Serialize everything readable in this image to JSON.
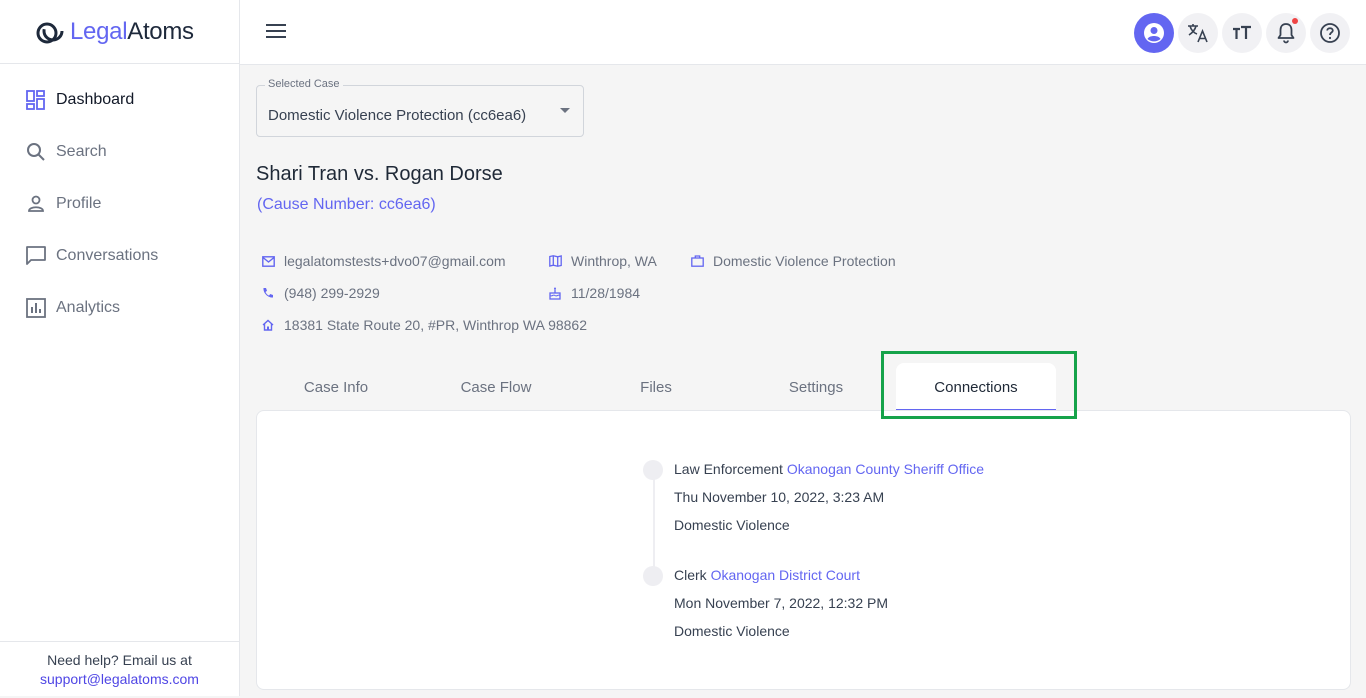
{
  "brand": {
    "part1": "Legal",
    "part2": "Atoms"
  },
  "sidebar": {
    "items": [
      {
        "label": "Dashboard",
        "icon": "dashboard-icon"
      },
      {
        "label": "Search",
        "icon": "search-icon"
      },
      {
        "label": "Profile",
        "icon": "person-icon"
      },
      {
        "label": "Conversations",
        "icon": "chat-icon"
      },
      {
        "label": "Analytics",
        "icon": "analytics-icon"
      }
    ],
    "help_text": "Need help? Email us at",
    "help_email": "support@legalatoms.com"
  },
  "topbar": {
    "actions": [
      "account-icon",
      "translate-icon",
      "text-size-icon",
      "notification-bell-icon",
      "help-icon"
    ]
  },
  "case_select": {
    "label": "Selected Case",
    "value": "Domestic Violence Protection (cc6ea6)"
  },
  "case": {
    "title": "Shari Tran vs. Rogan Dorse",
    "cause": "(Cause Number: cc6ea6)",
    "email": "legalatomstests+dvo07@gmail.com",
    "location": "Winthrop, WA",
    "case_type": "Domestic Violence Protection",
    "phone": "(948) 299-2929",
    "dob": "11/28/1984",
    "address": "18381 State Route 20, #PR, Winthrop WA 98862"
  },
  "tabs": [
    {
      "label": "Case Info"
    },
    {
      "label": "Case Flow"
    },
    {
      "label": "Files"
    },
    {
      "label": "Settings"
    },
    {
      "label": "Connections",
      "active": true
    }
  ],
  "connections": [
    {
      "role": "Law Enforcement",
      "org": "Okanogan County Sheriff Office",
      "date": "Thu November 10, 2022, 3:23 AM",
      "type": "Domestic Violence"
    },
    {
      "role": "Clerk",
      "org": "Okanogan District Court",
      "date": "Mon November 7, 2022, 12:32 PM",
      "type": "Domestic Violence"
    }
  ],
  "colors": {
    "accent": "#6366f1",
    "highlight": "#16a34a",
    "notification": "#ef4444"
  }
}
